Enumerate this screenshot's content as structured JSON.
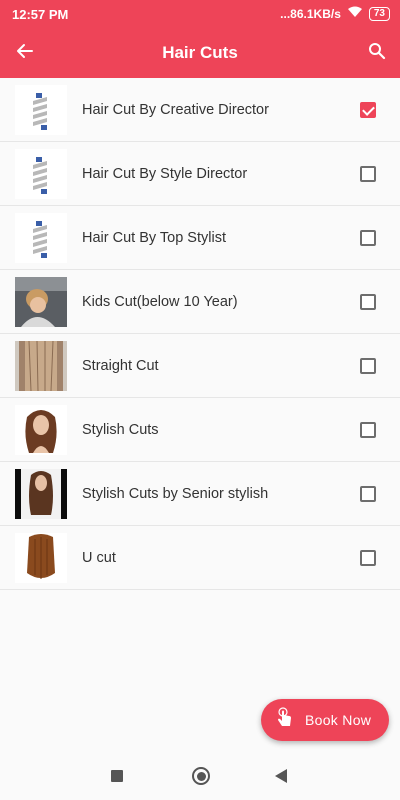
{
  "status_bar": {
    "time": "12:57 PM",
    "net_speed": "...86.1KB/s",
    "battery": "73"
  },
  "app_bar": {
    "title": "Hair Cuts",
    "back_icon": "arrow-left-icon",
    "search_icon": "search-icon"
  },
  "colors": {
    "accent": "#ee4458"
  },
  "services": [
    {
      "label": "Hair Cut By Creative Director",
      "checked": true,
      "thumb": "salon-logo"
    },
    {
      "label": "Hair Cut By Style Director",
      "checked": false,
      "thumb": "salon-logo"
    },
    {
      "label": "Hair Cut By Top Stylist",
      "checked": false,
      "thumb": "salon-logo"
    },
    {
      "label": "Kids Cut(below 10 Year)",
      "checked": false,
      "thumb": "kid-haircut-photo"
    },
    {
      "label": "Straight Cut",
      "checked": false,
      "thumb": "straight-hair-photo"
    },
    {
      "label": "Stylish Cuts",
      "checked": false,
      "thumb": "woman-layered-hair-photo"
    },
    {
      "label": "Stylish Cuts by Senior stylish",
      "checked": false,
      "thumb": "woman-long-hair-photo"
    },
    {
      "label": "U cut",
      "checked": false,
      "thumb": "u-cut-hair-photo"
    }
  ],
  "fab": {
    "label": "Book Now",
    "icon": "tap-hand-icon"
  }
}
